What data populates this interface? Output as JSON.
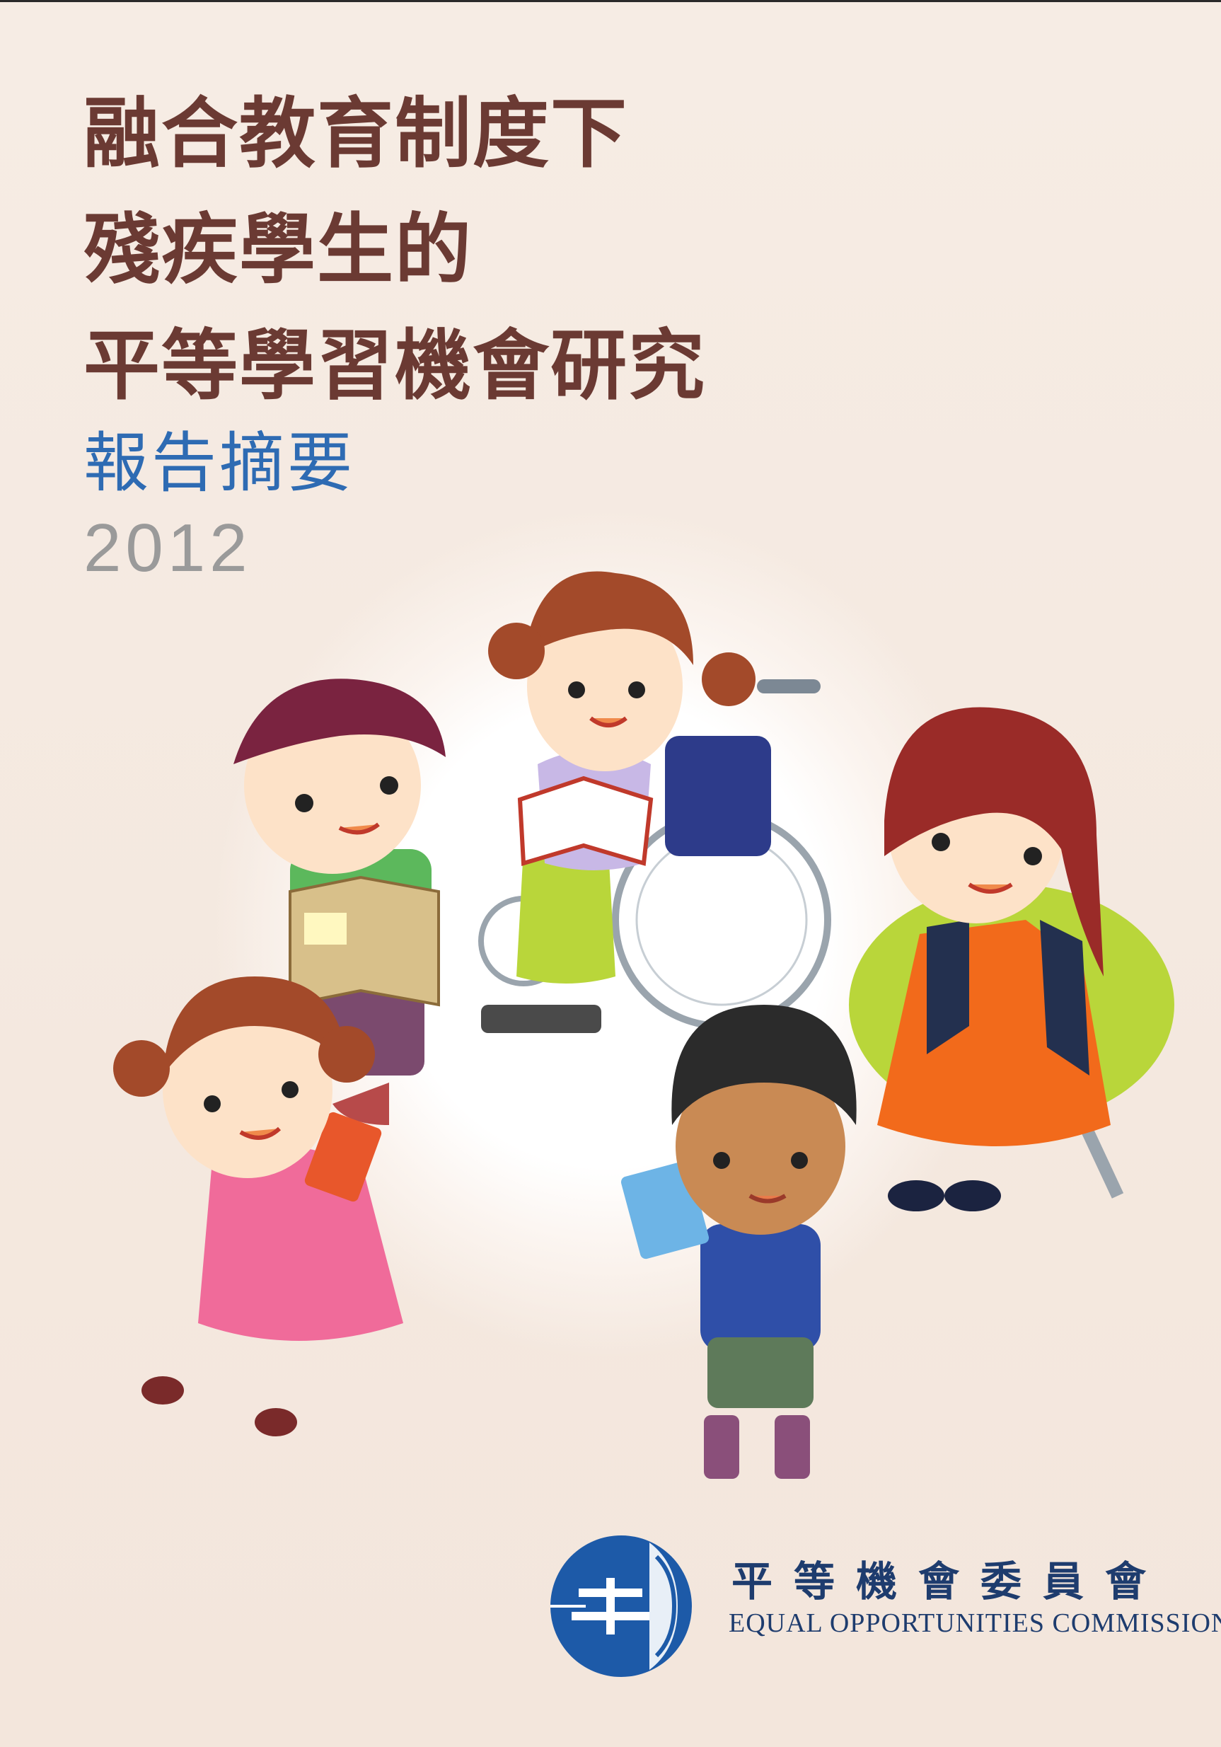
{
  "cover": {
    "title_lines": [
      "融合教育制度下",
      "殘疾學生的",
      "平等學習機會研究"
    ],
    "subtitle": "報告摘要",
    "year": "2012"
  },
  "illustration": {
    "subject": "children-reading-icon",
    "colors": {
      "title": "#6b3a33",
      "subtitle": "#2e6bb3",
      "year": "#9a9a9a",
      "logo_blue": "#1e3c6e"
    }
  },
  "organization": {
    "name_zh": "平等機會委員會",
    "name_en": "EQUAL OPPORTUNITIES COMMISSION",
    "logo": "eoc-logo-icon"
  }
}
